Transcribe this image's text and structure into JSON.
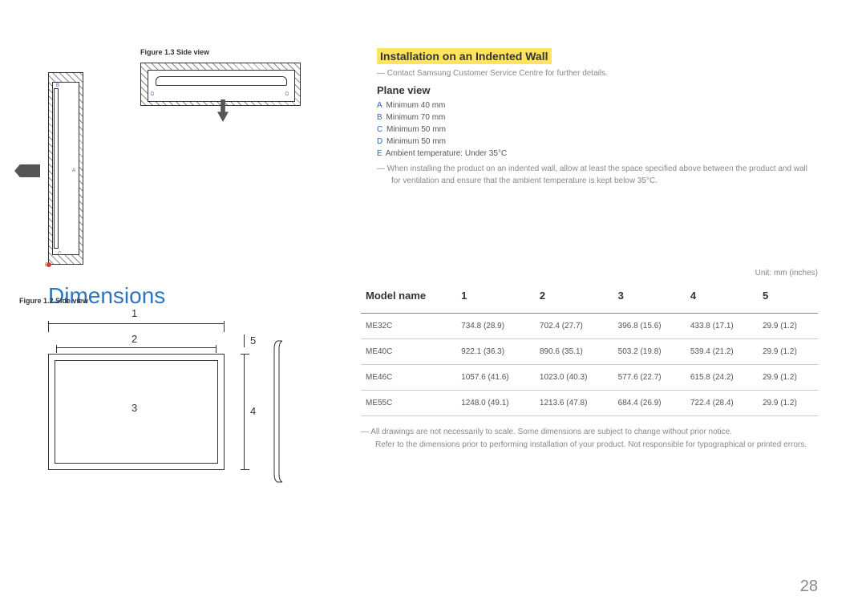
{
  "figure12": {
    "caption": "Figure 1.2 Side view",
    "labels": {
      "a": "A",
      "b": "B",
      "c": "C",
      "e": "E"
    }
  },
  "figure13": {
    "caption": "Figure 1.3 Side view",
    "labels": {
      "d": "D"
    }
  },
  "install": {
    "title": "Installation on an Indented Wall",
    "contact_note": "Contact Samsung Customer Service Centre for further details.",
    "plane_view_title": "Plane view",
    "specs": {
      "a": {
        "label": "A",
        "text": "Minimum 40 mm"
      },
      "b": {
        "label": "B",
        "text": "Minimum 70 mm"
      },
      "c": {
        "label": "C",
        "text": "Minimum 50 mm"
      },
      "d": {
        "label": "D",
        "text": "Minimum 50 mm"
      },
      "e": {
        "label": "E",
        "text": "Ambient temperature: Under 35°C"
      }
    },
    "vent_note": "When installing the product on an indented wall, allow at least the space specified above between the product and wall for ventilation and ensure that the ambient temperature is kept below 35°C."
  },
  "dimensions": {
    "heading": "Dimensions",
    "unit": "Unit: mm (inches)",
    "headers": {
      "model": "Model name",
      "c1": "1",
      "c2": "2",
      "c3": "3",
      "c4": "4",
      "c5": "5"
    },
    "rows": [
      {
        "model": "ME32C",
        "c1": "734.8 (28.9)",
        "c2": "702.4 (27.7)",
        "c3": "396.8 (15.6)",
        "c4": "433.8 (17.1)",
        "c5": "29.9 (1.2)"
      },
      {
        "model": "ME40C",
        "c1": "922.1 (36.3)",
        "c2": "890.6 (35.1)",
        "c3": "503.2 (19.8)",
        "c4": "539.4 (21.2)",
        "c5": "29.9 (1.2)"
      },
      {
        "model": "ME46C",
        "c1": "1057.6 (41.6)",
        "c2": "1023.0 (40.3)",
        "c3": "577.6 (22.7)",
        "c4": "615.8 (24.2)",
        "c5": "29.9 (1.2)"
      },
      {
        "model": "ME55C",
        "c1": "1248.0 (49.1)",
        "c2": "1213.6 (47.8)",
        "c3": "684.4 (26.9)",
        "c4": "722.4 (28.4)",
        "c5": "29.9 (1.2)"
      }
    ],
    "note1": "All drawings are not necessarily to scale. Some dimensions are subject to change without prior notice.",
    "note2": "Refer to the dimensions prior to performing installation of your product. Not responsible for typographical or printed errors.",
    "dia_labels": {
      "n1": "1",
      "n2": "2",
      "n3": "3",
      "n4": "4",
      "n5": "5"
    }
  },
  "page_number": "28"
}
